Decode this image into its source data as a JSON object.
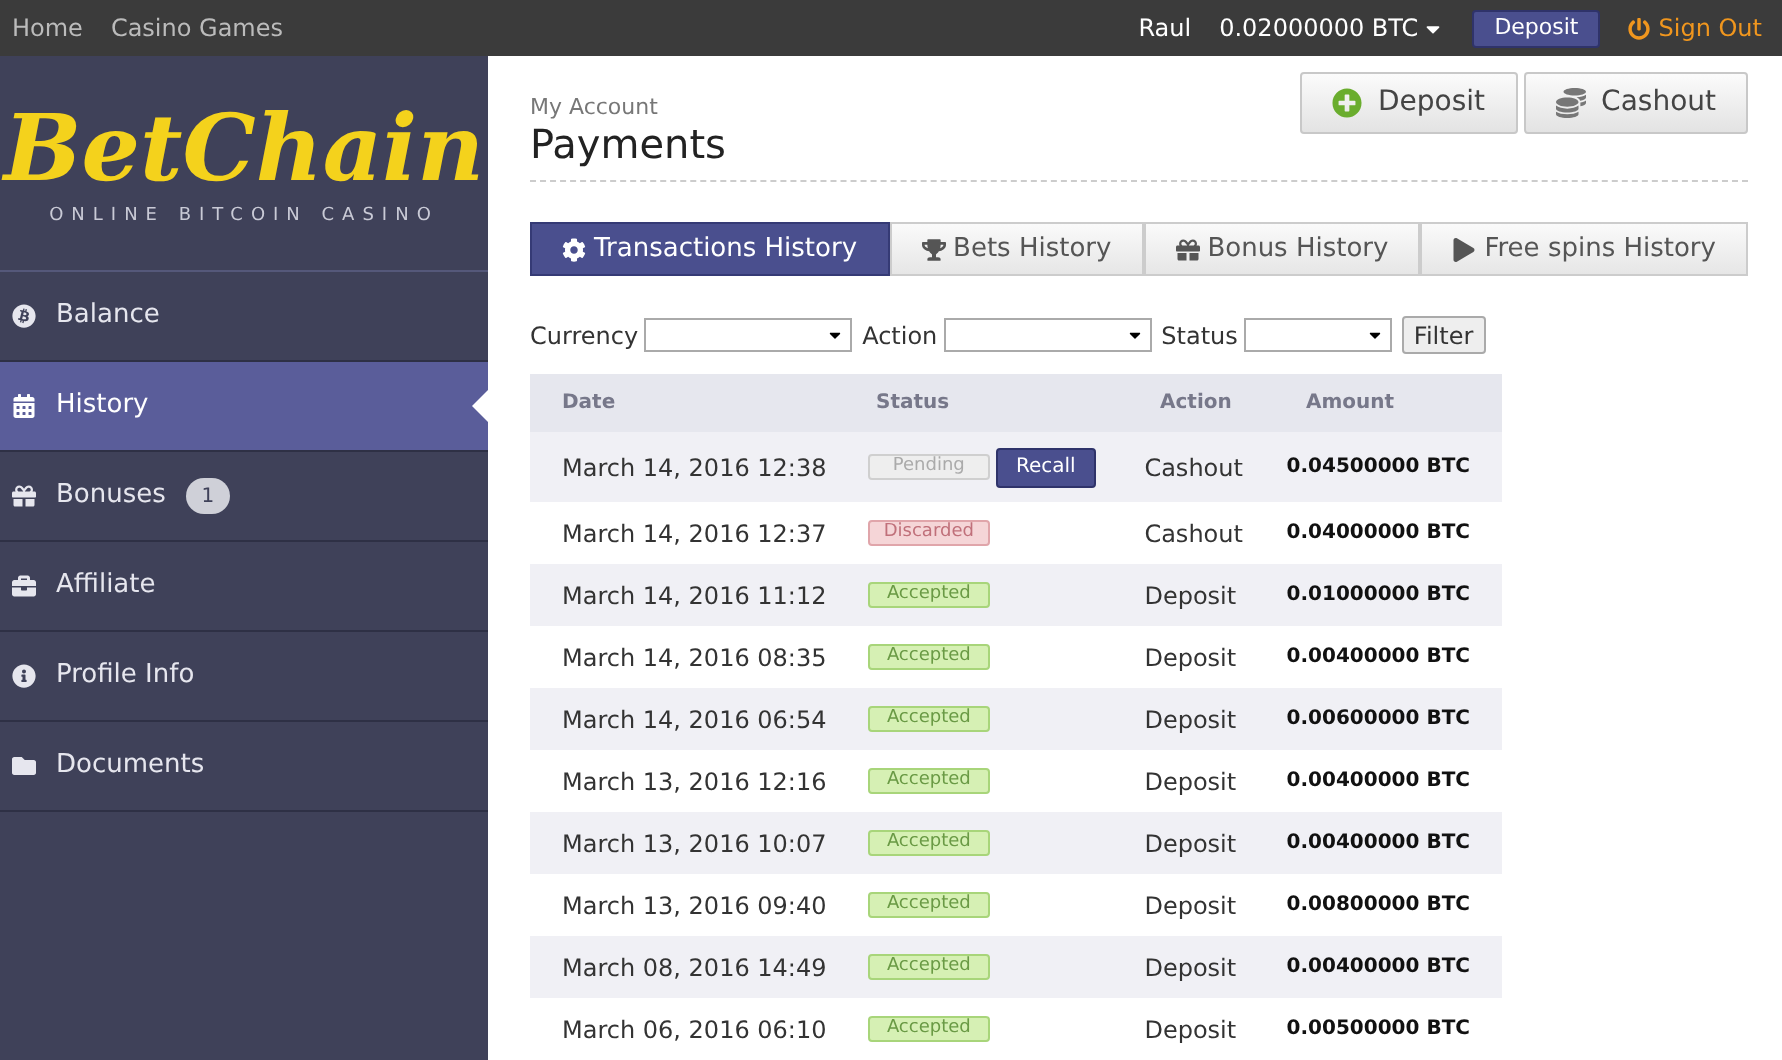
{
  "top_nav": {
    "links": [
      "Home",
      "Casino Games"
    ],
    "user": "Raul",
    "balance": "0.02000000 BTC",
    "deposit": "Deposit",
    "sign_out": "Sign Out"
  },
  "logo": {
    "name": "BetChain",
    "tagline": "ONLINE BITCOIN CASINO"
  },
  "sidebar": {
    "items": [
      {
        "label": "Balance",
        "kind": "balance",
        "selected": false
      },
      {
        "label": "History",
        "kind": "history",
        "selected": true
      },
      {
        "label": "Bonuses",
        "kind": "bonuses",
        "selected": false,
        "badge": "1"
      },
      {
        "label": "Affiliate",
        "kind": "affiliate",
        "selected": false
      },
      {
        "label": "Profile Info",
        "kind": "profile",
        "selected": false
      },
      {
        "label": "Documents",
        "kind": "documents",
        "selected": false
      }
    ]
  },
  "header": {
    "breadcrumb": "My Account",
    "title": "Payments",
    "buttons": [
      {
        "label": "Deposit",
        "kind": "deposit"
      },
      {
        "label": "Cashout",
        "kind": "cashout"
      }
    ]
  },
  "tabs": [
    {
      "label": "Transactions History",
      "kind": "transactions",
      "selected": true
    },
    {
      "label": "Bets History",
      "kind": "bets",
      "selected": false
    },
    {
      "label": "Bonus History",
      "kind": "bonus",
      "selected": false
    },
    {
      "label": "Free spins History",
      "kind": "spins",
      "selected": false
    }
  ],
  "filters": {
    "fields": [
      "Currency",
      "Action",
      "Status"
    ],
    "button": "Filter"
  },
  "table": {
    "columns": [
      "Date",
      "Status",
      "Action",
      "Amount"
    ],
    "rows": [
      {
        "date": "March 14, 2016 12:38",
        "status": "Pending",
        "kind": "pending",
        "recall": "Recall",
        "action": "Cashout",
        "amount": "0.04500000 BTC"
      },
      {
        "date": "March 14, 2016 12:37",
        "status": "Discarded",
        "kind": "discarded",
        "action": "Cashout",
        "amount": "0.04000000 BTC"
      },
      {
        "date": "March 14, 2016 11:12",
        "status": "Accepted",
        "kind": "accepted",
        "action": "Deposit",
        "amount": "0.01000000 BTC"
      },
      {
        "date": "March 14, 2016 08:35",
        "status": "Accepted",
        "kind": "accepted",
        "action": "Deposit",
        "amount": "0.00400000 BTC"
      },
      {
        "date": "March 14, 2016 06:54",
        "status": "Accepted",
        "kind": "accepted",
        "action": "Deposit",
        "amount": "0.00600000 BTC"
      },
      {
        "date": "March 13, 2016 12:16",
        "status": "Accepted",
        "kind": "accepted",
        "action": "Deposit",
        "amount": "0.00400000 BTC"
      },
      {
        "date": "March 13, 2016 10:07",
        "status": "Accepted",
        "kind": "accepted",
        "action": "Deposit",
        "amount": "0.00400000 BTC"
      },
      {
        "date": "March 13, 2016 09:40",
        "status": "Accepted",
        "kind": "accepted",
        "action": "Deposit",
        "amount": "0.00800000 BTC"
      },
      {
        "date": "March 08, 2016 14:49",
        "status": "Accepted",
        "kind": "accepted",
        "action": "Deposit",
        "amount": "0.00400000 BTC"
      },
      {
        "date": "March 06, 2016 06:10",
        "status": "Accepted",
        "kind": "accepted",
        "action": "Deposit",
        "amount": "0.00500000 BTC"
      }
    ]
  }
}
